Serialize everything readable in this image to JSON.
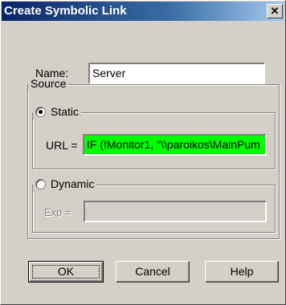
{
  "window": {
    "title": "Create Symbolic Link",
    "close_glyph": "✕"
  },
  "name": {
    "label": "Name:",
    "value": "Server"
  },
  "source": {
    "title": "Source",
    "static": {
      "label": "Static",
      "selected": true,
      "url_label": "URL =",
      "url_value": "IF (!Monitor1, \"\\\\paroikos\\MainPum",
      "url_bg": "#00ff00"
    },
    "dynamic": {
      "label": "Dynamic",
      "selected": false,
      "exp_label": "Exp =",
      "exp_value": ""
    }
  },
  "buttons": {
    "ok": "OK",
    "cancel": "Cancel",
    "help": "Help"
  }
}
